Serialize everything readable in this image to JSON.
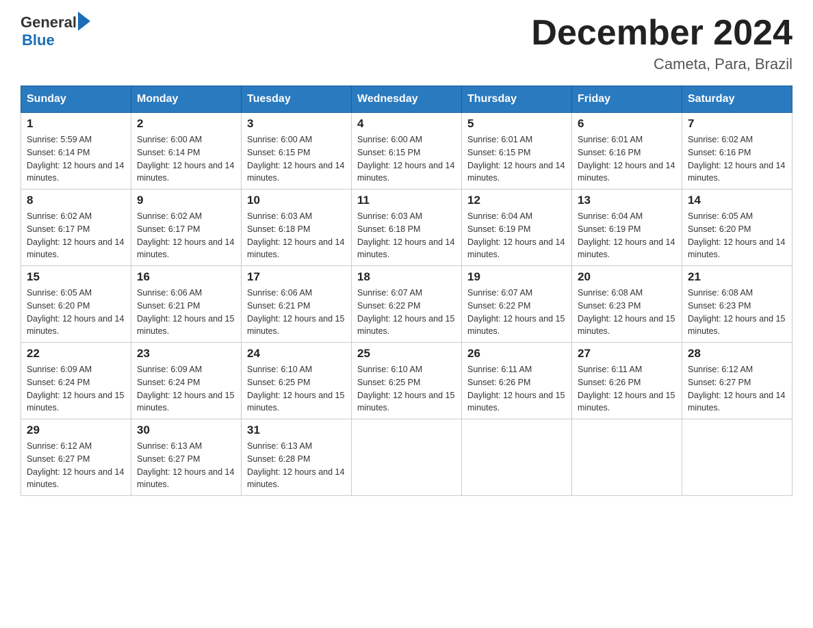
{
  "header": {
    "logo_general": "General",
    "logo_blue": "Blue",
    "month_title": "December 2024",
    "subtitle": "Cameta, Para, Brazil"
  },
  "weekdays": [
    "Sunday",
    "Monday",
    "Tuesday",
    "Wednesday",
    "Thursday",
    "Friday",
    "Saturday"
  ],
  "weeks": [
    [
      {
        "day": "1",
        "sunrise": "5:59 AM",
        "sunset": "6:14 PM",
        "daylight": "12 hours and 14 minutes."
      },
      {
        "day": "2",
        "sunrise": "6:00 AM",
        "sunset": "6:14 PM",
        "daylight": "12 hours and 14 minutes."
      },
      {
        "day": "3",
        "sunrise": "6:00 AM",
        "sunset": "6:15 PM",
        "daylight": "12 hours and 14 minutes."
      },
      {
        "day": "4",
        "sunrise": "6:00 AM",
        "sunset": "6:15 PM",
        "daylight": "12 hours and 14 minutes."
      },
      {
        "day": "5",
        "sunrise": "6:01 AM",
        "sunset": "6:15 PM",
        "daylight": "12 hours and 14 minutes."
      },
      {
        "day": "6",
        "sunrise": "6:01 AM",
        "sunset": "6:16 PM",
        "daylight": "12 hours and 14 minutes."
      },
      {
        "day": "7",
        "sunrise": "6:02 AM",
        "sunset": "6:16 PM",
        "daylight": "12 hours and 14 minutes."
      }
    ],
    [
      {
        "day": "8",
        "sunrise": "6:02 AM",
        "sunset": "6:17 PM",
        "daylight": "12 hours and 14 minutes."
      },
      {
        "day": "9",
        "sunrise": "6:02 AM",
        "sunset": "6:17 PM",
        "daylight": "12 hours and 14 minutes."
      },
      {
        "day": "10",
        "sunrise": "6:03 AM",
        "sunset": "6:18 PM",
        "daylight": "12 hours and 14 minutes."
      },
      {
        "day": "11",
        "sunrise": "6:03 AM",
        "sunset": "6:18 PM",
        "daylight": "12 hours and 14 minutes."
      },
      {
        "day": "12",
        "sunrise": "6:04 AM",
        "sunset": "6:19 PM",
        "daylight": "12 hours and 14 minutes."
      },
      {
        "day": "13",
        "sunrise": "6:04 AM",
        "sunset": "6:19 PM",
        "daylight": "12 hours and 14 minutes."
      },
      {
        "day": "14",
        "sunrise": "6:05 AM",
        "sunset": "6:20 PM",
        "daylight": "12 hours and 14 minutes."
      }
    ],
    [
      {
        "day": "15",
        "sunrise": "6:05 AM",
        "sunset": "6:20 PM",
        "daylight": "12 hours and 14 minutes."
      },
      {
        "day": "16",
        "sunrise": "6:06 AM",
        "sunset": "6:21 PM",
        "daylight": "12 hours and 15 minutes."
      },
      {
        "day": "17",
        "sunrise": "6:06 AM",
        "sunset": "6:21 PM",
        "daylight": "12 hours and 15 minutes."
      },
      {
        "day": "18",
        "sunrise": "6:07 AM",
        "sunset": "6:22 PM",
        "daylight": "12 hours and 15 minutes."
      },
      {
        "day": "19",
        "sunrise": "6:07 AM",
        "sunset": "6:22 PM",
        "daylight": "12 hours and 15 minutes."
      },
      {
        "day": "20",
        "sunrise": "6:08 AM",
        "sunset": "6:23 PM",
        "daylight": "12 hours and 15 minutes."
      },
      {
        "day": "21",
        "sunrise": "6:08 AM",
        "sunset": "6:23 PM",
        "daylight": "12 hours and 15 minutes."
      }
    ],
    [
      {
        "day": "22",
        "sunrise": "6:09 AM",
        "sunset": "6:24 PM",
        "daylight": "12 hours and 15 minutes."
      },
      {
        "day": "23",
        "sunrise": "6:09 AM",
        "sunset": "6:24 PM",
        "daylight": "12 hours and 15 minutes."
      },
      {
        "day": "24",
        "sunrise": "6:10 AM",
        "sunset": "6:25 PM",
        "daylight": "12 hours and 15 minutes."
      },
      {
        "day": "25",
        "sunrise": "6:10 AM",
        "sunset": "6:25 PM",
        "daylight": "12 hours and 15 minutes."
      },
      {
        "day": "26",
        "sunrise": "6:11 AM",
        "sunset": "6:26 PM",
        "daylight": "12 hours and 15 minutes."
      },
      {
        "day": "27",
        "sunrise": "6:11 AM",
        "sunset": "6:26 PM",
        "daylight": "12 hours and 15 minutes."
      },
      {
        "day": "28",
        "sunrise": "6:12 AM",
        "sunset": "6:27 PM",
        "daylight": "12 hours and 14 minutes."
      }
    ],
    [
      {
        "day": "29",
        "sunrise": "6:12 AM",
        "sunset": "6:27 PM",
        "daylight": "12 hours and 14 minutes."
      },
      {
        "day": "30",
        "sunrise": "6:13 AM",
        "sunset": "6:27 PM",
        "daylight": "12 hours and 14 minutes."
      },
      {
        "day": "31",
        "sunrise": "6:13 AM",
        "sunset": "6:28 PM",
        "daylight": "12 hours and 14 minutes."
      },
      null,
      null,
      null,
      null
    ]
  ]
}
